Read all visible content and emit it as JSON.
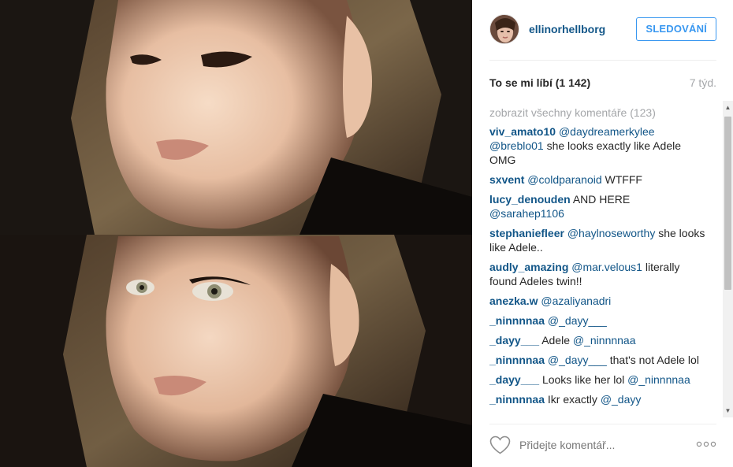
{
  "post": {
    "username": "ellinorhellborg",
    "follow_label": "SLEDOVÁNÍ",
    "likes_label": "To se mi líbí",
    "likes_count": "(1 142)",
    "age": "7 týd.",
    "view_all_comments": "zobrazit všechny komentáře (123)"
  },
  "comments": [
    {
      "user": "viv_amato10",
      "mentions": [
        "@daydreamerkylee",
        "@breblo01"
      ],
      "text": "she looks exactly like Adele OMG"
    },
    {
      "user": "sxvent",
      "mentions": [
        "@coldparanoid"
      ],
      "text": "WTFFF"
    },
    {
      "user": "lucy_denouden",
      "mentions": [],
      "text": "AND HERE",
      "trailing_mention": "@sarahep1106"
    },
    {
      "user": "stephaniefleer",
      "mentions": [
        "@haylnoseworthy"
      ],
      "text": "she looks like Adele.."
    },
    {
      "user": "audly_amazing",
      "mentions": [
        "@mar.velous1"
      ],
      "text": "literally found Adeles twin!!"
    },
    {
      "user": "anezka.w",
      "mentions": [
        "@azaliyanadri"
      ],
      "text": ""
    },
    {
      "user": "_ninnnnaa",
      "mentions": [
        "@_dayy___"
      ],
      "text": ""
    },
    {
      "user": "_dayy___",
      "mentions": [],
      "text": "Adele",
      "trailing_mention": "@_ninnnnaa"
    },
    {
      "user": "_ninnnnaa",
      "mentions": [
        "@_dayy___"
      ],
      "text": "that's not Adele lol"
    },
    {
      "user": "_dayy___",
      "mentions": [],
      "text": "Looks like her lol",
      "trailing_mention": "@_ninnnnaa"
    },
    {
      "user": "_ninnnnaa",
      "mentions": [],
      "text": "Ikr exactly",
      "trailing_mention": "@_dayy"
    }
  ],
  "footer": {
    "comment_placeholder": "Přidejte komentář...",
    "like_icon": "heart-outline-icon",
    "more_icon": "more-options-icon"
  },
  "colors": {
    "username_blue": "#125688",
    "follow_blue": "#3897f0",
    "muted_gray": "#a5a7aa"
  }
}
